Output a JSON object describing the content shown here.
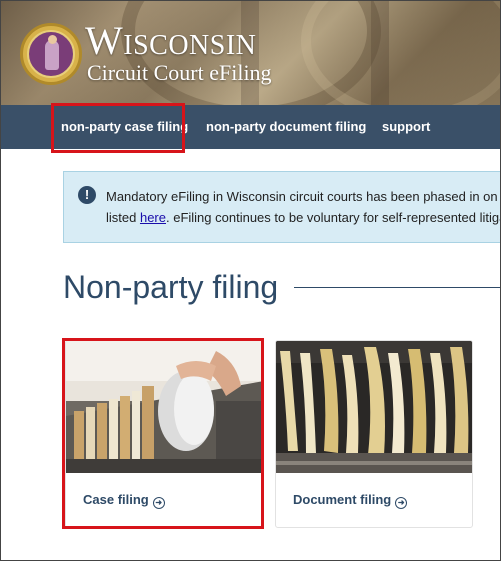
{
  "header": {
    "title": "Wisconsin",
    "subtitle": "Circuit Court eFiling",
    "seal_icon": "wisconsin-court-seal-icon"
  },
  "nav": {
    "items": [
      {
        "label": "non-party case filing"
      },
      {
        "label": "non-party document filing"
      },
      {
        "label": "support"
      }
    ]
  },
  "alert": {
    "icon": "exclamation-icon",
    "line1": "Mandatory eFiling in Wisconsin circuit courts has been phased in on",
    "line2_before": "listed ",
    "link": "here",
    "line2_after": ". eFiling continues to be voluntary for self-represented litiga"
  },
  "main": {
    "heading": "Non-party filing",
    "cards": [
      {
        "label": "Case filing",
        "icon": "arrow-right-circle-icon"
      },
      {
        "label": "Document filing",
        "icon": "arrow-right-circle-icon"
      }
    ]
  },
  "colors": {
    "nav_bg": "#3a5068",
    "heading": "#2e4a67",
    "alert_bg": "#d8ecf5",
    "highlight": "#d7141a"
  }
}
